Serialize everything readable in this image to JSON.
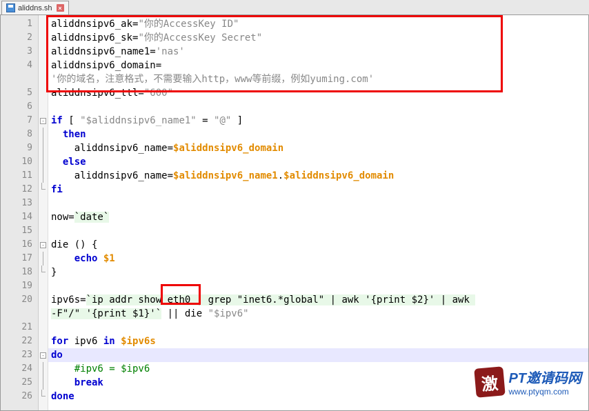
{
  "tab": {
    "filename": "aliddns.sh"
  },
  "lines": [
    {
      "n": 1,
      "tokens": [
        {
          "c": "norm",
          "t": "aliddnsipv6_ak="
        },
        {
          "c": "str",
          "t": "\"你的AccessKey ID\""
        }
      ]
    },
    {
      "n": 2,
      "tokens": [
        {
          "c": "norm",
          "t": "aliddnsipv6_sk="
        },
        {
          "c": "str",
          "t": "\"你的AccessKey Secret\""
        }
      ]
    },
    {
      "n": 3,
      "tokens": [
        {
          "c": "norm",
          "t": "aliddnsipv6_name1="
        },
        {
          "c": "str",
          "t": "'nas'"
        }
      ]
    },
    {
      "n": 4,
      "tokens": [
        {
          "c": "norm",
          "t": "aliddnsipv6_domain="
        }
      ]
    },
    {
      "n": "",
      "tokens": [
        {
          "c": "str",
          "t": "'你的域名，注意格式，不需要输入http，www等前缀，例如yuming.com'"
        }
      ]
    },
    {
      "n": 5,
      "tokens": [
        {
          "c": "norm",
          "t": "aliddnsipv6_ttl="
        },
        {
          "c": "str",
          "t": "\"600\""
        }
      ]
    },
    {
      "n": 6,
      "tokens": []
    },
    {
      "n": 7,
      "fold": "open",
      "tokens": [
        {
          "c": "kw",
          "t": "if"
        },
        {
          "c": "norm",
          "t": " [ "
        },
        {
          "c": "str",
          "t": "\"$aliddnsipv6_name1\""
        },
        {
          "c": "norm",
          "t": " = "
        },
        {
          "c": "str",
          "t": "\"@\""
        },
        {
          "c": "norm",
          "t": " ]"
        }
      ]
    },
    {
      "n": 8,
      "fold": "line",
      "tokens": [
        {
          "c": "norm",
          "t": "  "
        },
        {
          "c": "kw",
          "t": "then"
        }
      ]
    },
    {
      "n": 9,
      "fold": "line",
      "tokens": [
        {
          "c": "norm",
          "t": "    aliddnsipv6_name="
        },
        {
          "c": "var",
          "t": "$aliddnsipv6_domain"
        }
      ]
    },
    {
      "n": 10,
      "fold": "line",
      "tokens": [
        {
          "c": "norm",
          "t": "  "
        },
        {
          "c": "kw",
          "t": "else"
        }
      ]
    },
    {
      "n": 11,
      "fold": "line",
      "tokens": [
        {
          "c": "norm",
          "t": "    aliddnsipv6_name="
        },
        {
          "c": "var",
          "t": "$aliddnsipv6_name1"
        },
        {
          "c": "norm",
          "t": "."
        },
        {
          "c": "var",
          "t": "$aliddnsipv6_domain"
        }
      ]
    },
    {
      "n": 12,
      "fold": "end",
      "tokens": [
        {
          "c": "kw",
          "t": "fi"
        }
      ]
    },
    {
      "n": 13,
      "tokens": []
    },
    {
      "n": 14,
      "tokens": [
        {
          "c": "norm",
          "t": "now="
        },
        {
          "c": "btk",
          "t": "`date`"
        }
      ]
    },
    {
      "n": 15,
      "tokens": []
    },
    {
      "n": 16,
      "fold": "open",
      "tokens": [
        {
          "c": "norm",
          "t": "die () {"
        }
      ]
    },
    {
      "n": 17,
      "fold": "line",
      "tokens": [
        {
          "c": "norm",
          "t": "    "
        },
        {
          "c": "kw",
          "t": "echo"
        },
        {
          "c": "norm",
          "t": " "
        },
        {
          "c": "var",
          "t": "$1"
        }
      ]
    },
    {
      "n": 18,
      "fold": "end",
      "tokens": [
        {
          "c": "norm",
          "t": "}"
        }
      ]
    },
    {
      "n": 19,
      "tokens": []
    },
    {
      "n": 20,
      "tokens": [
        {
          "c": "norm",
          "t": "ipv6s="
        },
        {
          "c": "btk",
          "t": "`ip addr show eth0 | grep \"inet6.*global\" | awk '{print $2}' | awk "
        }
      ]
    },
    {
      "n": "",
      "tokens": [
        {
          "c": "btk",
          "t": "-F\"/\" '{print $1}'`"
        },
        {
          "c": "norm",
          "t": " || die "
        },
        {
          "c": "str",
          "t": "\"$ipv6\""
        }
      ]
    },
    {
      "n": 21,
      "tokens": []
    },
    {
      "n": 22,
      "tokens": [
        {
          "c": "kw",
          "t": "for"
        },
        {
          "c": "norm",
          "t": " ipv6 "
        },
        {
          "c": "kw",
          "t": "in"
        },
        {
          "c": "norm",
          "t": " "
        },
        {
          "c": "var",
          "t": "$ipv6s"
        }
      ]
    },
    {
      "n": 23,
      "fold": "open",
      "hl": true,
      "tokens": [
        {
          "c": "kw",
          "t": "do"
        }
      ]
    },
    {
      "n": 24,
      "fold": "line",
      "tokens": [
        {
          "c": "norm",
          "t": "    "
        },
        {
          "c": "cmt",
          "t": "#ipv6 = $ipv6"
        }
      ]
    },
    {
      "n": 25,
      "fold": "line",
      "tokens": [
        {
          "c": "norm",
          "t": "    "
        },
        {
          "c": "kw",
          "t": "break"
        }
      ]
    },
    {
      "n": 26,
      "fold": "end",
      "tokens": [
        {
          "c": "kw",
          "t": "done"
        }
      ]
    }
  ],
  "watermark": {
    "badge": "激",
    "title": "PT邀请码网",
    "url": "www.ptyqm.com"
  }
}
